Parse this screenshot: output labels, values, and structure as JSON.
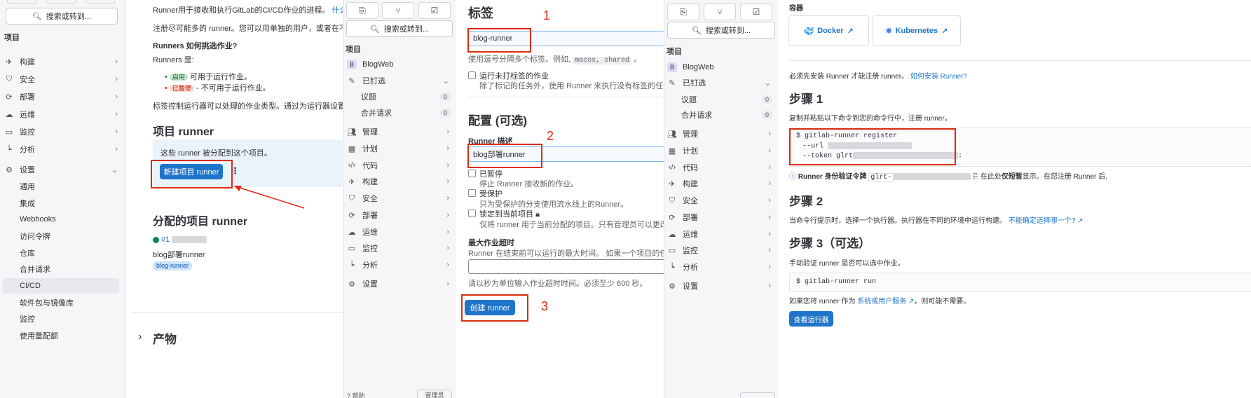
{
  "panel1": {
    "search_label": "搜索或转到...",
    "section_title": "项目",
    "nav": [
      {
        "label": "构建",
        "icon": "rocket-icon"
      },
      {
        "label": "安全",
        "icon": "shield-icon"
      },
      {
        "label": "部署",
        "icon": "deploy-icon"
      },
      {
        "label": "运维",
        "icon": "cloud-icon"
      },
      {
        "label": "监控",
        "icon": "monitor-icon"
      },
      {
        "label": "分析",
        "icon": "chart-icon"
      },
      {
        "label": "设置",
        "icon": "gear-icon"
      }
    ],
    "settings_sub": [
      "通用",
      "集成",
      "Webhooks",
      "访问令牌",
      "仓库",
      "合并请求",
      "CI/CD",
      "软件包与镜像库",
      "监控",
      "使用量配额"
    ],
    "main": {
      "intro": "Runner用于接收和执行GitLab的CI/CD作业的进程。",
      "intro_link": "什么是 Ru",
      "intro2": "注册尽可能多的 runner。您可以用单独的用户，或者在不同的服",
      "how_title": "Runners 如何挑选作业?",
      "runners_are": "Runners 是:",
      "bullet1_badge": "启用",
      "bullet1_text": "可用于运行作业。",
      "bullet2_badge": "已暂停",
      "bullet2_text": "- 不可用于运行作业。",
      "tags_note": "标签控制运行器可以处理的作业类型。通过为运行器设置标签,",
      "project_runner_title": "项目 runner",
      "assigned_note": "这些 runner 被分配到这个项目。",
      "new_runner_button": "新建项目 runner",
      "assigned_title": "分配的项目 runner",
      "runner_id": "#1",
      "runner_desc": "blog部署runner",
      "runner_tag": "blog-runner",
      "products_title": "产物"
    }
  },
  "panel2": {
    "search_label": "搜索或转到...",
    "section_title": "项目",
    "project_avatar": "B",
    "project_name": "BlogWeb",
    "pinned": "已钉选",
    "issues": {
      "label": "议题",
      "count": "0"
    },
    "mrs": {
      "label": "合并请求",
      "count": "0"
    },
    "nav": [
      {
        "label": "管理",
        "icon": "users-icon"
      },
      {
        "label": "计划",
        "icon": "calendar-icon"
      },
      {
        "label": "代码",
        "icon": "code-icon"
      },
      {
        "label": "构建",
        "icon": "rocket-icon"
      },
      {
        "label": "安全",
        "icon": "shield-icon"
      },
      {
        "label": "部署",
        "icon": "deploy-icon"
      },
      {
        "label": "运维",
        "icon": "cloud-icon"
      },
      {
        "label": "监控",
        "icon": "monitor-icon"
      },
      {
        "label": "分析",
        "icon": "chart-icon"
      },
      {
        "label": "设置",
        "icon": "gear-icon"
      }
    ],
    "bottom_left": "帮助",
    "bottom_right": "管理员"
  },
  "form": {
    "tags_title": "标签",
    "tags_value": "blog-runner",
    "tags_help_prefix": "使用逗号分隔多个标签。例如,",
    "tags_help_example": "macos, shared",
    "untagged_label": "运行未打标签的作业",
    "untagged_help": "除了标记的任务外，使用 Runner 来执行没有标签的任务。",
    "config_title": "配置 (可选)",
    "desc_label": "Runner 描述",
    "desc_value": "blog部署runner",
    "paused_label": "已暂停",
    "paused_help": "停止 Runner 接收新的作业。",
    "protected_label": "受保护",
    "protected_help": "只为受保护的分支使用流水线上的Runner。",
    "locked_label": "锁定到当前项目",
    "locked_help": "仅将 runner 用于当前分配的项目。只有管理员可以更改分配的项",
    "timeout_label": "最大作业超时",
    "timeout_help": "Runner 在结束前可以运行的最大时间。 如果一个项目的任务超时时",
    "timeout_note": "请以秒为单位输入作业超时时间。必须至少 600 秒。",
    "create_button": "创建 runner",
    "marker1": "1",
    "marker2": "2",
    "marker3": "3"
  },
  "panel3": {
    "search_label": "搜索或转到...",
    "section_title": "项目",
    "project_avatar": "B",
    "project_name": "BlogWeb",
    "pinned": "已钉选",
    "issues": {
      "label": "议题",
      "count": "0"
    },
    "mrs": {
      "label": "合并请求",
      "count": "0"
    },
    "nav": [
      {
        "label": "管理",
        "icon": "users-icon"
      },
      {
        "label": "计划",
        "icon": "calendar-icon"
      },
      {
        "label": "代码",
        "icon": "code-icon"
      },
      {
        "label": "构建",
        "icon": "rocket-icon"
      },
      {
        "label": "安全",
        "icon": "shield-icon"
      },
      {
        "label": "部署",
        "icon": "deploy-icon"
      },
      {
        "label": "运维",
        "icon": "cloud-icon"
      },
      {
        "label": "监控",
        "icon": "monitor-icon"
      },
      {
        "label": "分析",
        "icon": "chart-icon"
      },
      {
        "label": "设置",
        "icon": "gear-icon"
      }
    ]
  },
  "register": {
    "containers_title": "容器",
    "docker": "Docker",
    "kubernetes": "Kubernetes",
    "must_install": "必须先安装 Runner 才能注册 runner。",
    "how_install": "如何安装 Runner?",
    "step1_title": "步骤 1",
    "step1_desc": "复制并粘贴以下命令到您的命令行中，注册 runner。",
    "cmd_line1": "$ gitlab-runner register",
    "cmd_line2": "--url",
    "cmd_line3": "--token glrt",
    "token_label": "Runner 身份验证令牌",
    "token_value": "glrt-",
    "token_note_prefix": "在此处",
    "token_note_bold": "仅短暂",
    "token_note_suffix": "显示。在您注册 Runner 后,",
    "step2_title": "步骤 2",
    "step2_desc": "当命令行提示时，选择一个执行器。执行器在不同的环境中运行构建。",
    "step2_link": "不能确定选择哪一个?",
    "step3_title": "步骤 3（可选）",
    "step3_desc": "手动验证 runner 是否可以选中作业。",
    "run_cmd": "$ gitlab-runner run",
    "service_prefix": "如果您将 runner 作为",
    "service_link": "系统或用户服务",
    "service_suffix": "，则可能不需要。",
    "view_runners_button": "查看运行器"
  }
}
